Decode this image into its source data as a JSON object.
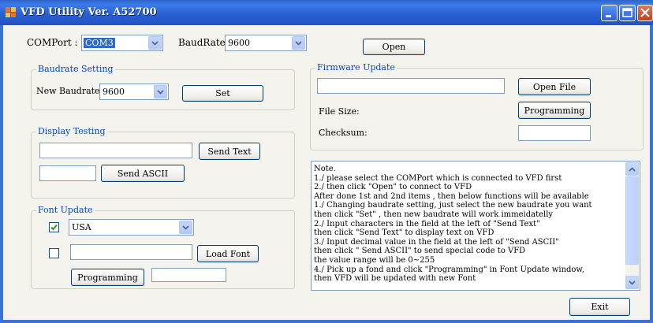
{
  "window": {
    "title": "VFD Utility Ver. A52700"
  },
  "colors": {
    "titlebar": "#2a60d2",
    "group_title": "#0046d5",
    "selection": "#316ac5",
    "close_button": "#c1401b"
  },
  "connection": {
    "comport_label": "COMPort :",
    "comport_value": "COM3",
    "baudrate_label": "BaudRate:",
    "baudrate_value": "9600",
    "open_label": "Open"
  },
  "baudrate_setting": {
    "title": "Baudrate Setting",
    "new_baudrate_label": "New Baudrate",
    "new_baudrate_value": "9600",
    "set_label": "Set"
  },
  "display_testing": {
    "title": "Display Testing",
    "send_text_label": "Send Text",
    "send_ascii_label": "Send ASCII",
    "text_value": "",
    "ascii_value": ""
  },
  "font_update": {
    "title": "Font Update",
    "font_checked": true,
    "font_value": "USA",
    "file_checked": false,
    "file_value": "",
    "load_font_label": "Load Font",
    "programming_label": "Programming",
    "progress_value": ""
  },
  "firmware_update": {
    "title": "Firmware Update",
    "file_value": "",
    "open_file_label": "Open File",
    "file_size_label": "File Size:",
    "programming_label": "Programming",
    "checksum_label": "Checksum:",
    "checksum_value": ""
  },
  "notes": {
    "lines": [
      "Note.",
      "1./ please select the COMPort which is connected to VFD first",
      "2./ then click \"Open\" to connect to VFD",
      "After done 1st and 2nd items , then below functions will be available",
      "1./ Changing baudrate setting, just select the new baudrate you want",
      "then click \"Set\" , then new baudrate will work immeidatelly",
      "2./ Input characters in the field at the left of \"Send Text\"",
      "then click \"Send Text\" to display text on VFD",
      "3./ Input decimal value in the field at the left of \"Send ASCII\"",
      "then click \" Send ASCII\" to send special code to VFD",
      "the value range will be 0~255",
      "4./ Pick up a fond and click \"Programming\" in Font Update window,",
      "then VFD will be updated with new Font"
    ]
  },
  "footer": {
    "exit_label": "Exit"
  },
  "icons": {
    "app": "app-icon",
    "minimize": "minimize-icon",
    "maximize": "maximize-icon",
    "close": "close-icon",
    "dropdown": "chevron-down-icon",
    "check": "check-icon"
  }
}
